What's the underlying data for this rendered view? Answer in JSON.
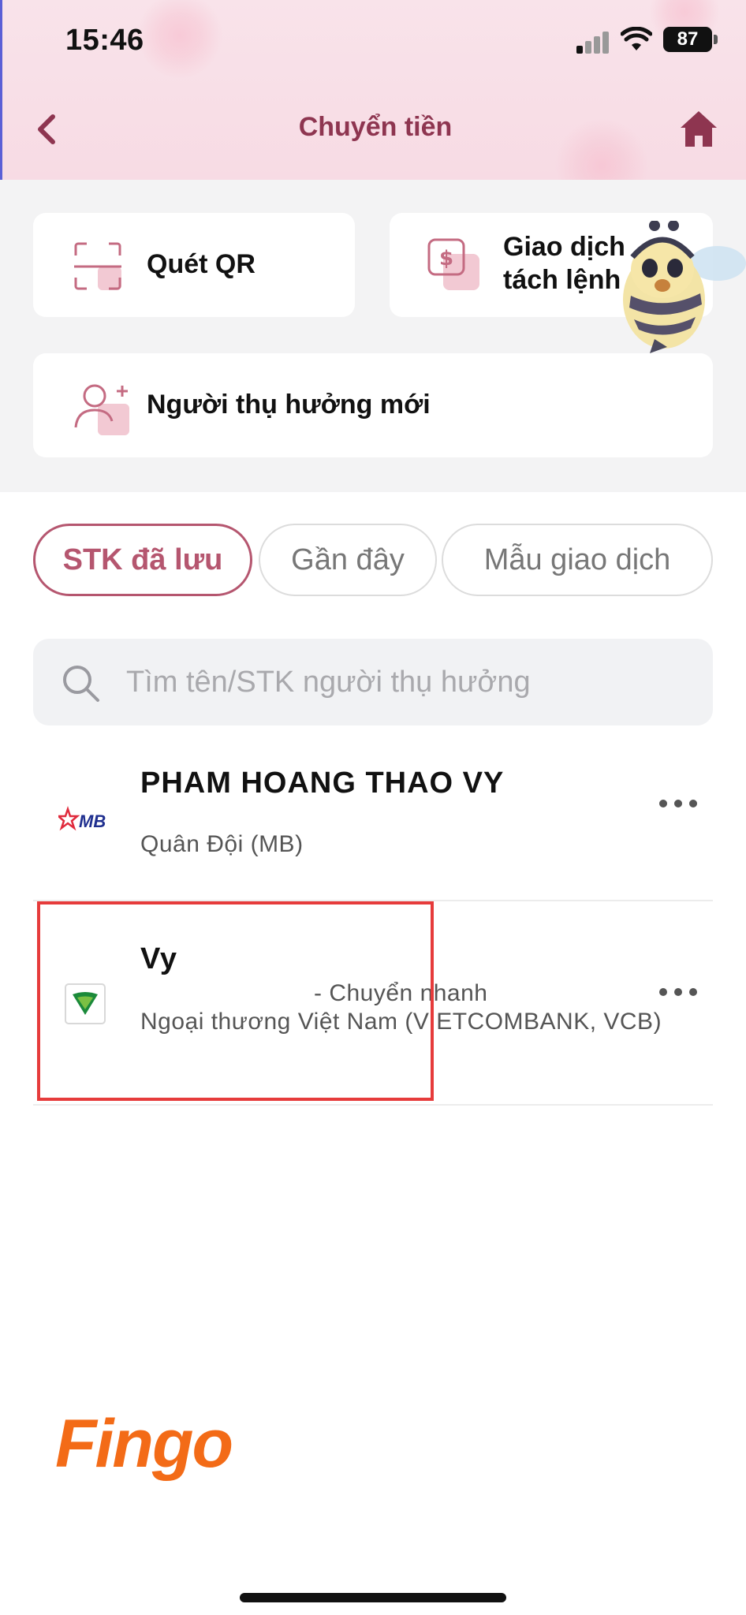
{
  "status_bar": {
    "time": "15:46",
    "battery": "87"
  },
  "header": {
    "title": "Chuyển tiền"
  },
  "actions": {
    "scan_qr": "Quét QR",
    "split_transaction_line1": "Giao dịch",
    "split_transaction_line2": "tách lệnh",
    "new_payee": "Người thụ hưởng mới"
  },
  "tabs": [
    {
      "label": "STK đã lưu",
      "active": true
    },
    {
      "label": "Gần đây",
      "active": false
    },
    {
      "label": "Mẫu giao dịch",
      "active": false
    }
  ],
  "search": {
    "placeholder": "Tìm tên/STK người thụ hưởng",
    "value": ""
  },
  "payees": [
    {
      "name": "PHAM HOANG THAO VY",
      "tag": "",
      "bank": "Quân Đội (MB)",
      "bank_logo_text": "MB"
    },
    {
      "name": "Vy",
      "tag": "- Chuyển nhanh",
      "bank": "Ngoại thương Việt Nam (VIETCOMBANK, VCB)",
      "bank_logo_text": ""
    }
  ],
  "brand": {
    "logo_text": "Fingo"
  },
  "colors": {
    "accent": "#8e3550",
    "tab_active": "#b5566f",
    "highlight": "#e63b3b",
    "brand": "#f36b17"
  }
}
